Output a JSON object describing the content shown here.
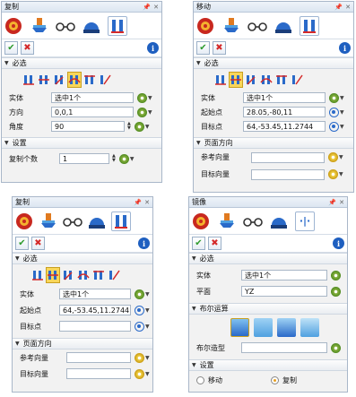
{
  "panels": {
    "p1": {
      "title": "复制",
      "sec_required": "必选",
      "entity_label": "实体",
      "entity_value": "选中1个",
      "direction_label": "方向",
      "direction_value": "0,0,1",
      "angle_label": "角度",
      "angle_value": "90",
      "sec_settings": "设置",
      "count_label": "复制个数",
      "count_value": "1"
    },
    "p2": {
      "title": "移动",
      "sec_required": "必选",
      "entity_label": "实体",
      "entity_value": "选中1个",
      "start_label": "起始点",
      "start_value": "28.05,-80,11",
      "target_label": "目标点",
      "target_value": "64,-53.45,11.2744",
      "sec_orient": "页面方向",
      "ref_label": "参考向量",
      "tgt_vec_label": "目标向量"
    },
    "p3": {
      "title": "复制",
      "sec_required": "必选",
      "entity_label": "实体",
      "entity_value": "选中1个",
      "start_label": "起始点",
      "start_value": "64,-53.45,11.2744",
      "target_label": "目标点",
      "sec_orient": "页面方向",
      "ref_label": "参考向量",
      "tgt_vec_label": "目标向量"
    },
    "p4": {
      "title": "镜像",
      "sec_required": "必选",
      "entity_label": "实体",
      "entity_value": "选中1个",
      "plane_label": "平面",
      "plane_value": "YZ",
      "sec_boolean": "布尔运算",
      "bool_shape_label": "布尔造型",
      "sec_settings": "设置",
      "opt_move": "移动",
      "opt_copy": "复制",
      "selected_option": "复制"
    }
  },
  "icons": [
    "wheel-icon",
    "stamp-icon",
    "glasses-icon",
    "dome-icon",
    "transform-icon"
  ],
  "colors": {
    "accent": "#2a6ac9",
    "ok": "#2e9b2e",
    "cancel": "#d42a2a",
    "highlight": "#f9d65a"
  }
}
